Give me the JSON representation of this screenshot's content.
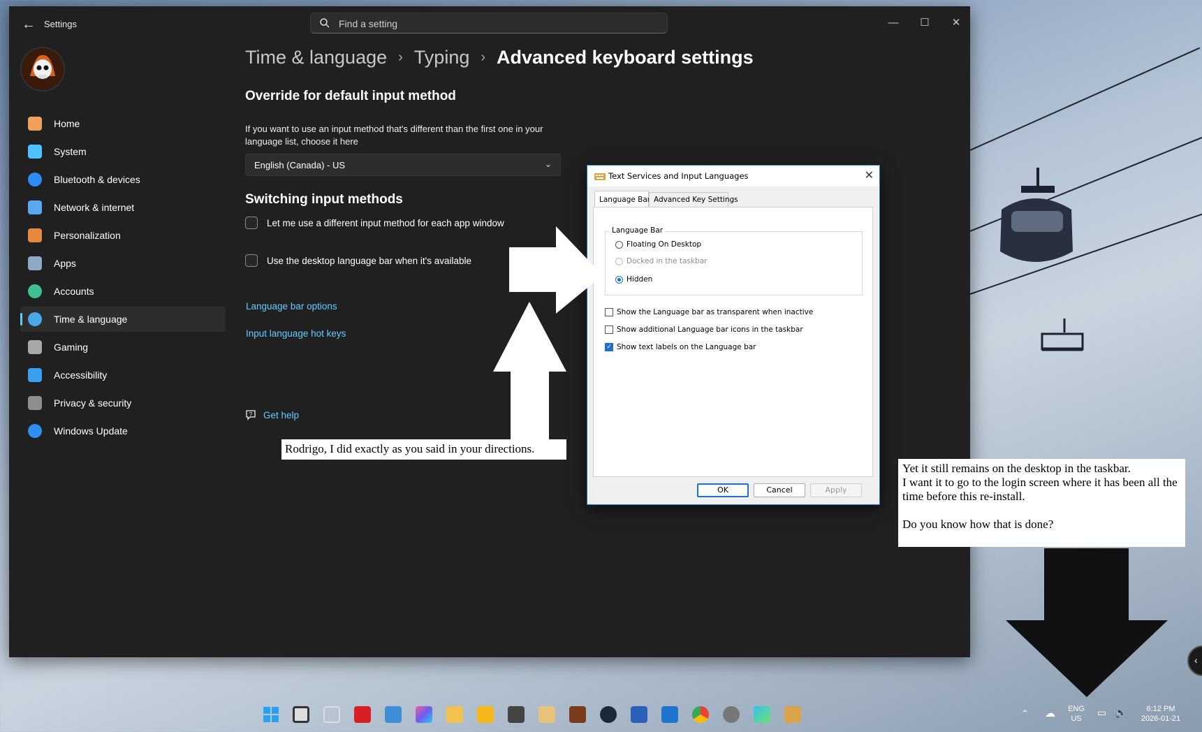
{
  "window": {
    "app_title": "Settings",
    "search_placeholder": "Find a setting",
    "minimize": "—",
    "maximize": "☐",
    "close": "✕"
  },
  "nav": {
    "items": [
      {
        "label": "Home",
        "icon": "home-icon",
        "color": "#f0a05a"
      },
      {
        "label": "System",
        "icon": "system-icon",
        "color": "#4cc2ff"
      },
      {
        "label": "Bluetooth & devices",
        "icon": "bluetooth-icon",
        "color": "#2f8cf5"
      },
      {
        "label": "Network & internet",
        "icon": "network-icon",
        "color": "#5aa9f0"
      },
      {
        "label": "Personalization",
        "icon": "brush-icon",
        "color": "#e58a3c"
      },
      {
        "label": "Apps",
        "icon": "apps-icon",
        "color": "#8fa8c8"
      },
      {
        "label": "Accounts",
        "icon": "accounts-icon",
        "color": "#3fbf8f"
      },
      {
        "label": "Time & language",
        "icon": "globe-clock-icon",
        "color": "#4aa8e8"
      },
      {
        "label": "Gaming",
        "icon": "gamepad-icon",
        "color": "#a8a8a8"
      },
      {
        "label": "Accessibility",
        "icon": "accessibility-icon",
        "color": "#3b9ff0"
      },
      {
        "label": "Privacy & security",
        "icon": "shield-icon",
        "color": "#8e8e8e"
      },
      {
        "label": "Windows Update",
        "icon": "update-icon",
        "color": "#2f8ef0"
      }
    ],
    "active": "Time & language"
  },
  "breadcrumb": {
    "part1": "Time & language",
    "part2": "Typing",
    "current": "Advanced keyboard settings",
    "separator": "›"
  },
  "override": {
    "heading": "Override for default input method",
    "description": "If you want to use an input method that's different than the first one in your language list, choose it here",
    "selected": "English (Canada) - US"
  },
  "switching": {
    "heading": "Switching input methods",
    "option1": "Let me use a different input method for each app window",
    "option2": "Use the desktop language bar when it's available",
    "option1_checked": false,
    "option2_checked": false
  },
  "links": {
    "language_bar_options": "Language bar options",
    "hot_keys": "Input language hot keys",
    "get_help": "Get help"
  },
  "dialog": {
    "title": "Text Services and Input Languages",
    "tabs": [
      "Language Bar",
      "Advanced Key Settings"
    ],
    "group_label": "Language Bar",
    "radio_floating": "Floating On Desktop",
    "radio_docked": "Docked in the taskbar",
    "radio_hidden": "Hidden",
    "selected_radio": "Hidden",
    "cb_transparent": "Show the Language bar as transparent when inactive",
    "cb_additional": "Show additional Language bar icons in the taskbar",
    "cb_text_labels": "Show text labels on the Language bar",
    "cb_transparent_checked": false,
    "cb_additional_checked": false,
    "cb_text_labels_checked": true,
    "ok": "OK",
    "cancel": "Cancel",
    "apply": "Apply"
  },
  "annotations": {
    "note1": "Rodrigo, I did exactly as you said in your directions.",
    "note2_line1": "Yet it still remains on the desktop in the taskbar.",
    "note2_line2": "I want it to go to the login screen where it has been all the time before this re-install.",
    "note2_line3": "Do you know how that is done?"
  },
  "taskbar": {
    "lang_top": "ENG",
    "lang_bottom": "US",
    "time": "6:12 PM",
    "date": "2026-01-21"
  },
  "colors": {
    "accent": "#60cdff",
    "window_bg": "#202020",
    "dialog_accent": "#1f6fd1"
  }
}
